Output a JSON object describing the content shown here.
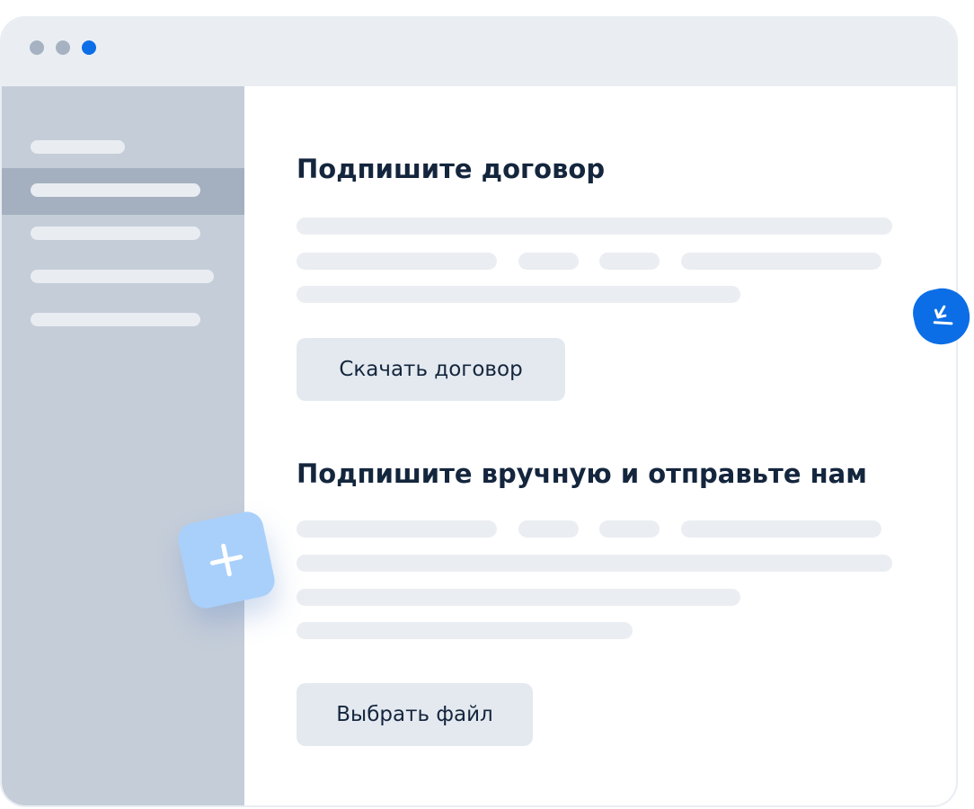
{
  "window": {
    "title_dots": [
      {
        "name": "window-dot-1",
        "color": "#a6b2c1"
      },
      {
        "name": "window-dot-2",
        "color": "#a6b2c1"
      },
      {
        "name": "window-dot-3",
        "color": "#0b6ee6"
      }
    ]
  },
  "sidebar": {
    "active_index": 1,
    "item_count": 5
  },
  "sections": [
    {
      "heading": "Подпишите договор",
      "button_label": "Скачать договор"
    },
    {
      "heading": "Подпишите вручную и отправьте нам",
      "button_label": "Выбрать файл"
    }
  ],
  "badges": {
    "download_icon": "download-icon",
    "plus_icon": "plus-icon",
    "accent_color": "#0b6ee6",
    "plus_bg_color": "#a9d0fb"
  }
}
